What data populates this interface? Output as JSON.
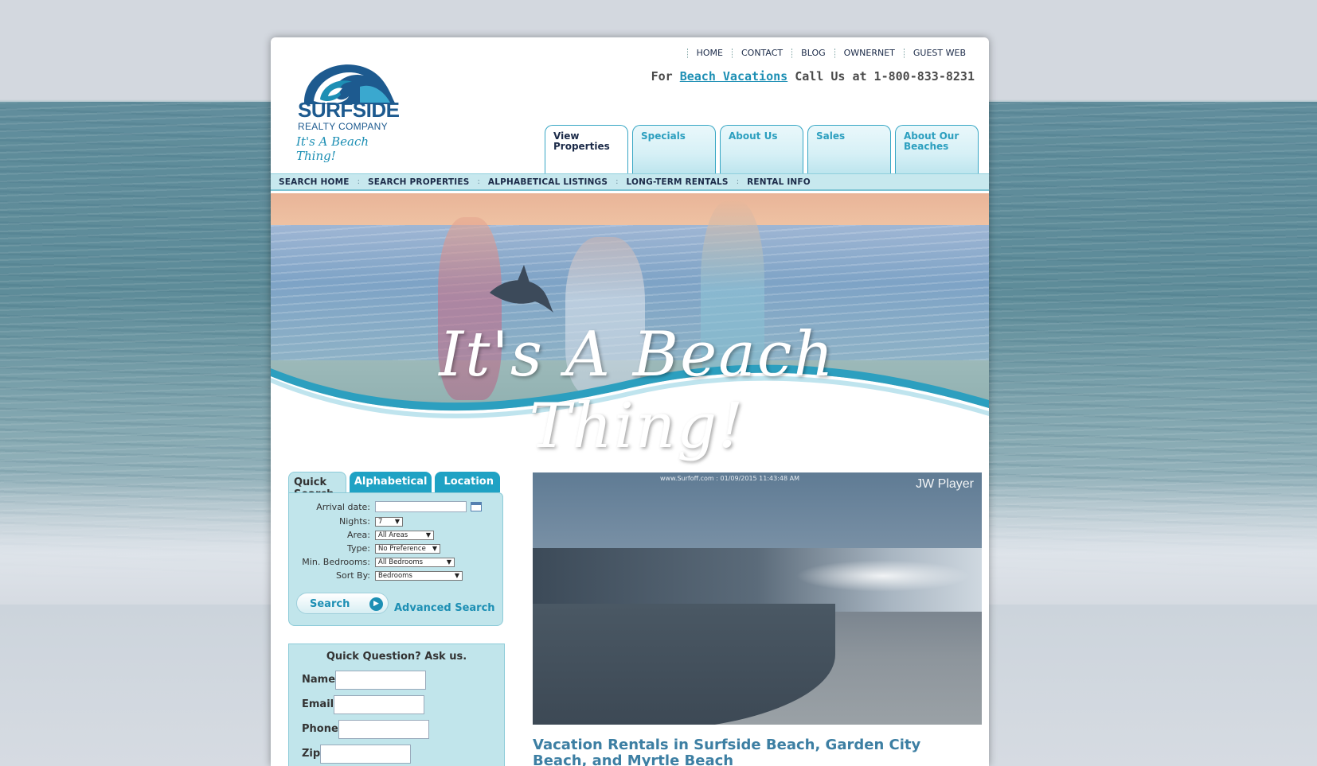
{
  "top_nav": [
    "HOME",
    "CONTACT",
    "BLOG",
    "OWNERNET",
    "GUEST WEB"
  ],
  "call": {
    "prefix": "For",
    "link": "Beach Vacations",
    "suffix": "Call Us at 1-800-833-8231"
  },
  "logo": {
    "name": "SURFSIDE",
    "sub": "REALTY COMPANY",
    "tagline": "It's A Beach Thing!"
  },
  "tabs": [
    "View Properties",
    "Specials",
    "About Us",
    "Sales",
    "About Our Beaches"
  ],
  "subnav": [
    "SEARCH HOME",
    "SEARCH PROPERTIES",
    "ALPHABETICAL LISTINGS",
    "LONG-TERM RENTALS",
    "RENTAL INFO"
  ],
  "hero_text": "It's A Beach Thing!",
  "quick_search": {
    "tabs": [
      "Quick Search",
      "Alphabetical",
      "Location"
    ],
    "arrival_label": "Arrival date:",
    "nights_label": "Nights:",
    "nights_value": "7",
    "area_label": "Area:",
    "area_value": "All Areas",
    "type_label": "Type:",
    "type_value": "No Preference",
    "bedrooms_label": "Min. Bedrooms:",
    "bedrooms_value": "All Bedrooms",
    "sort_label": "Sort By:",
    "sort_value": "Bedrooms",
    "search_button": "Search",
    "advanced_link": "Advanced Search"
  },
  "quick_question": {
    "title": "Quick Question? Ask us.",
    "fields": [
      "Name",
      "Email",
      "Phone",
      "Zip"
    ]
  },
  "video": {
    "stamp": "www.Surfoff.com  :  01/09/2015 11:43:48 AM",
    "player": "JW Player"
  },
  "heading": "Vacation Rentals in Surfside Beach, Garden City Beach, and Myrtle Beach",
  "colors": {
    "accent": "#1d8fb4",
    "panel": "#c1e5eb",
    "navy": "#1b2a48"
  }
}
